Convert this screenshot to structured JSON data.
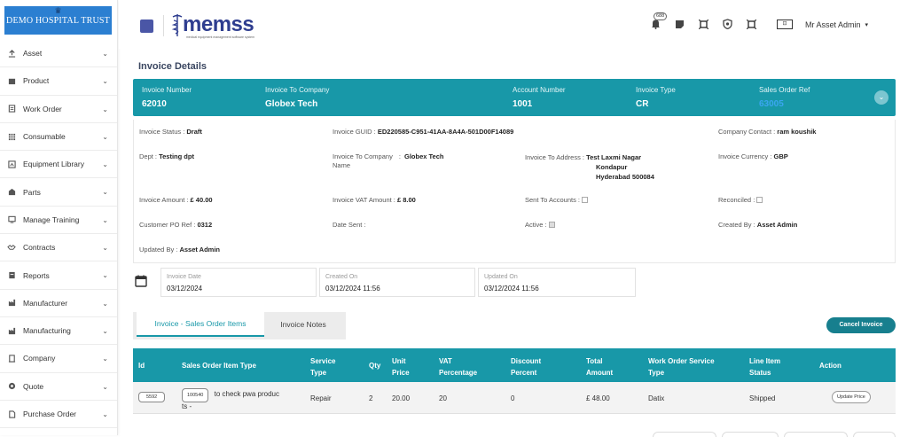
{
  "sidebar": {
    "logo_text": "DEMO HOSPITAL TRUST",
    "items": [
      {
        "label": "Asset",
        "icon": "upload-icon"
      },
      {
        "label": "Product",
        "icon": "box-icon"
      },
      {
        "label": "Work Order",
        "icon": "clipboard-icon"
      },
      {
        "label": "Consumable",
        "icon": "grid-icon"
      },
      {
        "label": "Equipment Library",
        "icon": "library-icon"
      },
      {
        "label": "Parts",
        "icon": "parts-icon"
      },
      {
        "label": "Manage Training",
        "icon": "training-icon"
      },
      {
        "label": "Contracts",
        "icon": "handshake-icon"
      },
      {
        "label": "Reports",
        "icon": "report-icon"
      },
      {
        "label": "Manufacturer",
        "icon": "factory-icon"
      },
      {
        "label": "Manufacturing",
        "icon": "factory-icon"
      },
      {
        "label": "Company",
        "icon": "building-icon"
      },
      {
        "label": "Quote",
        "icon": "quote-icon"
      },
      {
        "label": "Purchase Order",
        "icon": "document-icon"
      }
    ]
  },
  "topbar": {
    "brand": "memss",
    "brand_tagline": "medical equipment management software system",
    "notification_count": "688",
    "user_name": "Mr Asset Admin"
  },
  "page": {
    "title": "Invoice Details"
  },
  "invoice_header": {
    "invoice_number_label": "Invoice Number",
    "invoice_number": "62010",
    "invoice_to_company_label": "Invoice To Company",
    "invoice_to_company": "Globex Tech",
    "account_number_label": "Account Number",
    "account_number": "1001",
    "invoice_type_label": "Invoice Type",
    "invoice_type": "CR",
    "sales_order_ref_label": "Sales Order Ref",
    "sales_order_ref": "63005"
  },
  "details": {
    "invoice_status_label": "Invoice Status :",
    "invoice_status": "Draft",
    "invoice_guid_label": "Invoice GUID :",
    "invoice_guid": "ED220585-C951-41AA-8A4A-501D00F14089",
    "company_contact_label": "Company Contact :",
    "company_contact": "ram koushik",
    "dept_label": "Dept :",
    "dept": "Testing dpt",
    "invoice_to_company_name_label_1": "Invoice To Company",
    "invoice_to_company_name_label_2": "Name",
    "invoice_to_company_name": "Globex Tech",
    "invoice_to_address_label": "Invoice To Address :",
    "address_line1": "Test Laxmi Nagar",
    "address_line2": "Kondapur",
    "address_line3": "Hyderabad 500084",
    "invoice_currency_label": "Invoice Currency :",
    "invoice_currency": "GBP",
    "invoice_amount_label": "Invoice Amount :",
    "invoice_amount": "£ 40.00",
    "invoice_vat_amount_label": "Invoice VAT Amount :",
    "invoice_vat_amount": "£ 8.00",
    "sent_to_accounts_label": "Sent To Accounts :",
    "sent_to_accounts": false,
    "reconciled_label": "Reconciled :",
    "reconciled": false,
    "customer_po_ref_label": "Customer PO Ref :",
    "customer_po_ref": "0312",
    "date_sent_label": "Date Sent :",
    "date_sent": "",
    "active_label": "Active :",
    "active": true,
    "created_by_label": "Created By :",
    "created_by": "Asset Admin",
    "updated_by_label": "Updated By :",
    "updated_by": "Asset Admin"
  },
  "dates": {
    "invoice_date_label": "Invoice Date",
    "invoice_date": "03/12/2024",
    "created_on_label": "Created On",
    "created_on": "03/12/2024 11:56",
    "updated_on_label": "Updated On",
    "updated_on": "03/12/2024 11:56"
  },
  "tabs": [
    {
      "label": "Invoice - Sales Order Items",
      "active": true
    },
    {
      "label": "Invoice Notes",
      "active": false
    }
  ],
  "actions": {
    "cancel_invoice": "Cancel Invoice"
  },
  "table": {
    "headers": {
      "id": "Id",
      "item_type": "Sales Order Item Type",
      "service_type_1": "Service",
      "service_type_2": "Type",
      "qty": "Qty",
      "unit_price_1": "Unit",
      "unit_price_2": "Price",
      "vat_1": "VAT",
      "vat_2": "Percentage",
      "discount_1": "Discount",
      "discount_2": "Percent",
      "total_1": "Total",
      "total_2": "Amount",
      "wo_service_1": "Work Order Service",
      "wo_service_2": "Type",
      "line_status_1": "Line Item",
      "line_status_2": "Status",
      "action": "Action"
    },
    "rows": [
      {
        "id": "5592",
        "item_code": "100540",
        "item_desc_1": "to check pwa produc",
        "item_desc_2": "ts -",
        "service_type": "Repair",
        "qty": "2",
        "unit_price": "20.00",
        "vat": "20",
        "discount": "0",
        "total": "£ 48.00",
        "wo_service_type": "Datix",
        "line_status": "Shipped",
        "action_label": "Update Price"
      }
    ]
  }
}
